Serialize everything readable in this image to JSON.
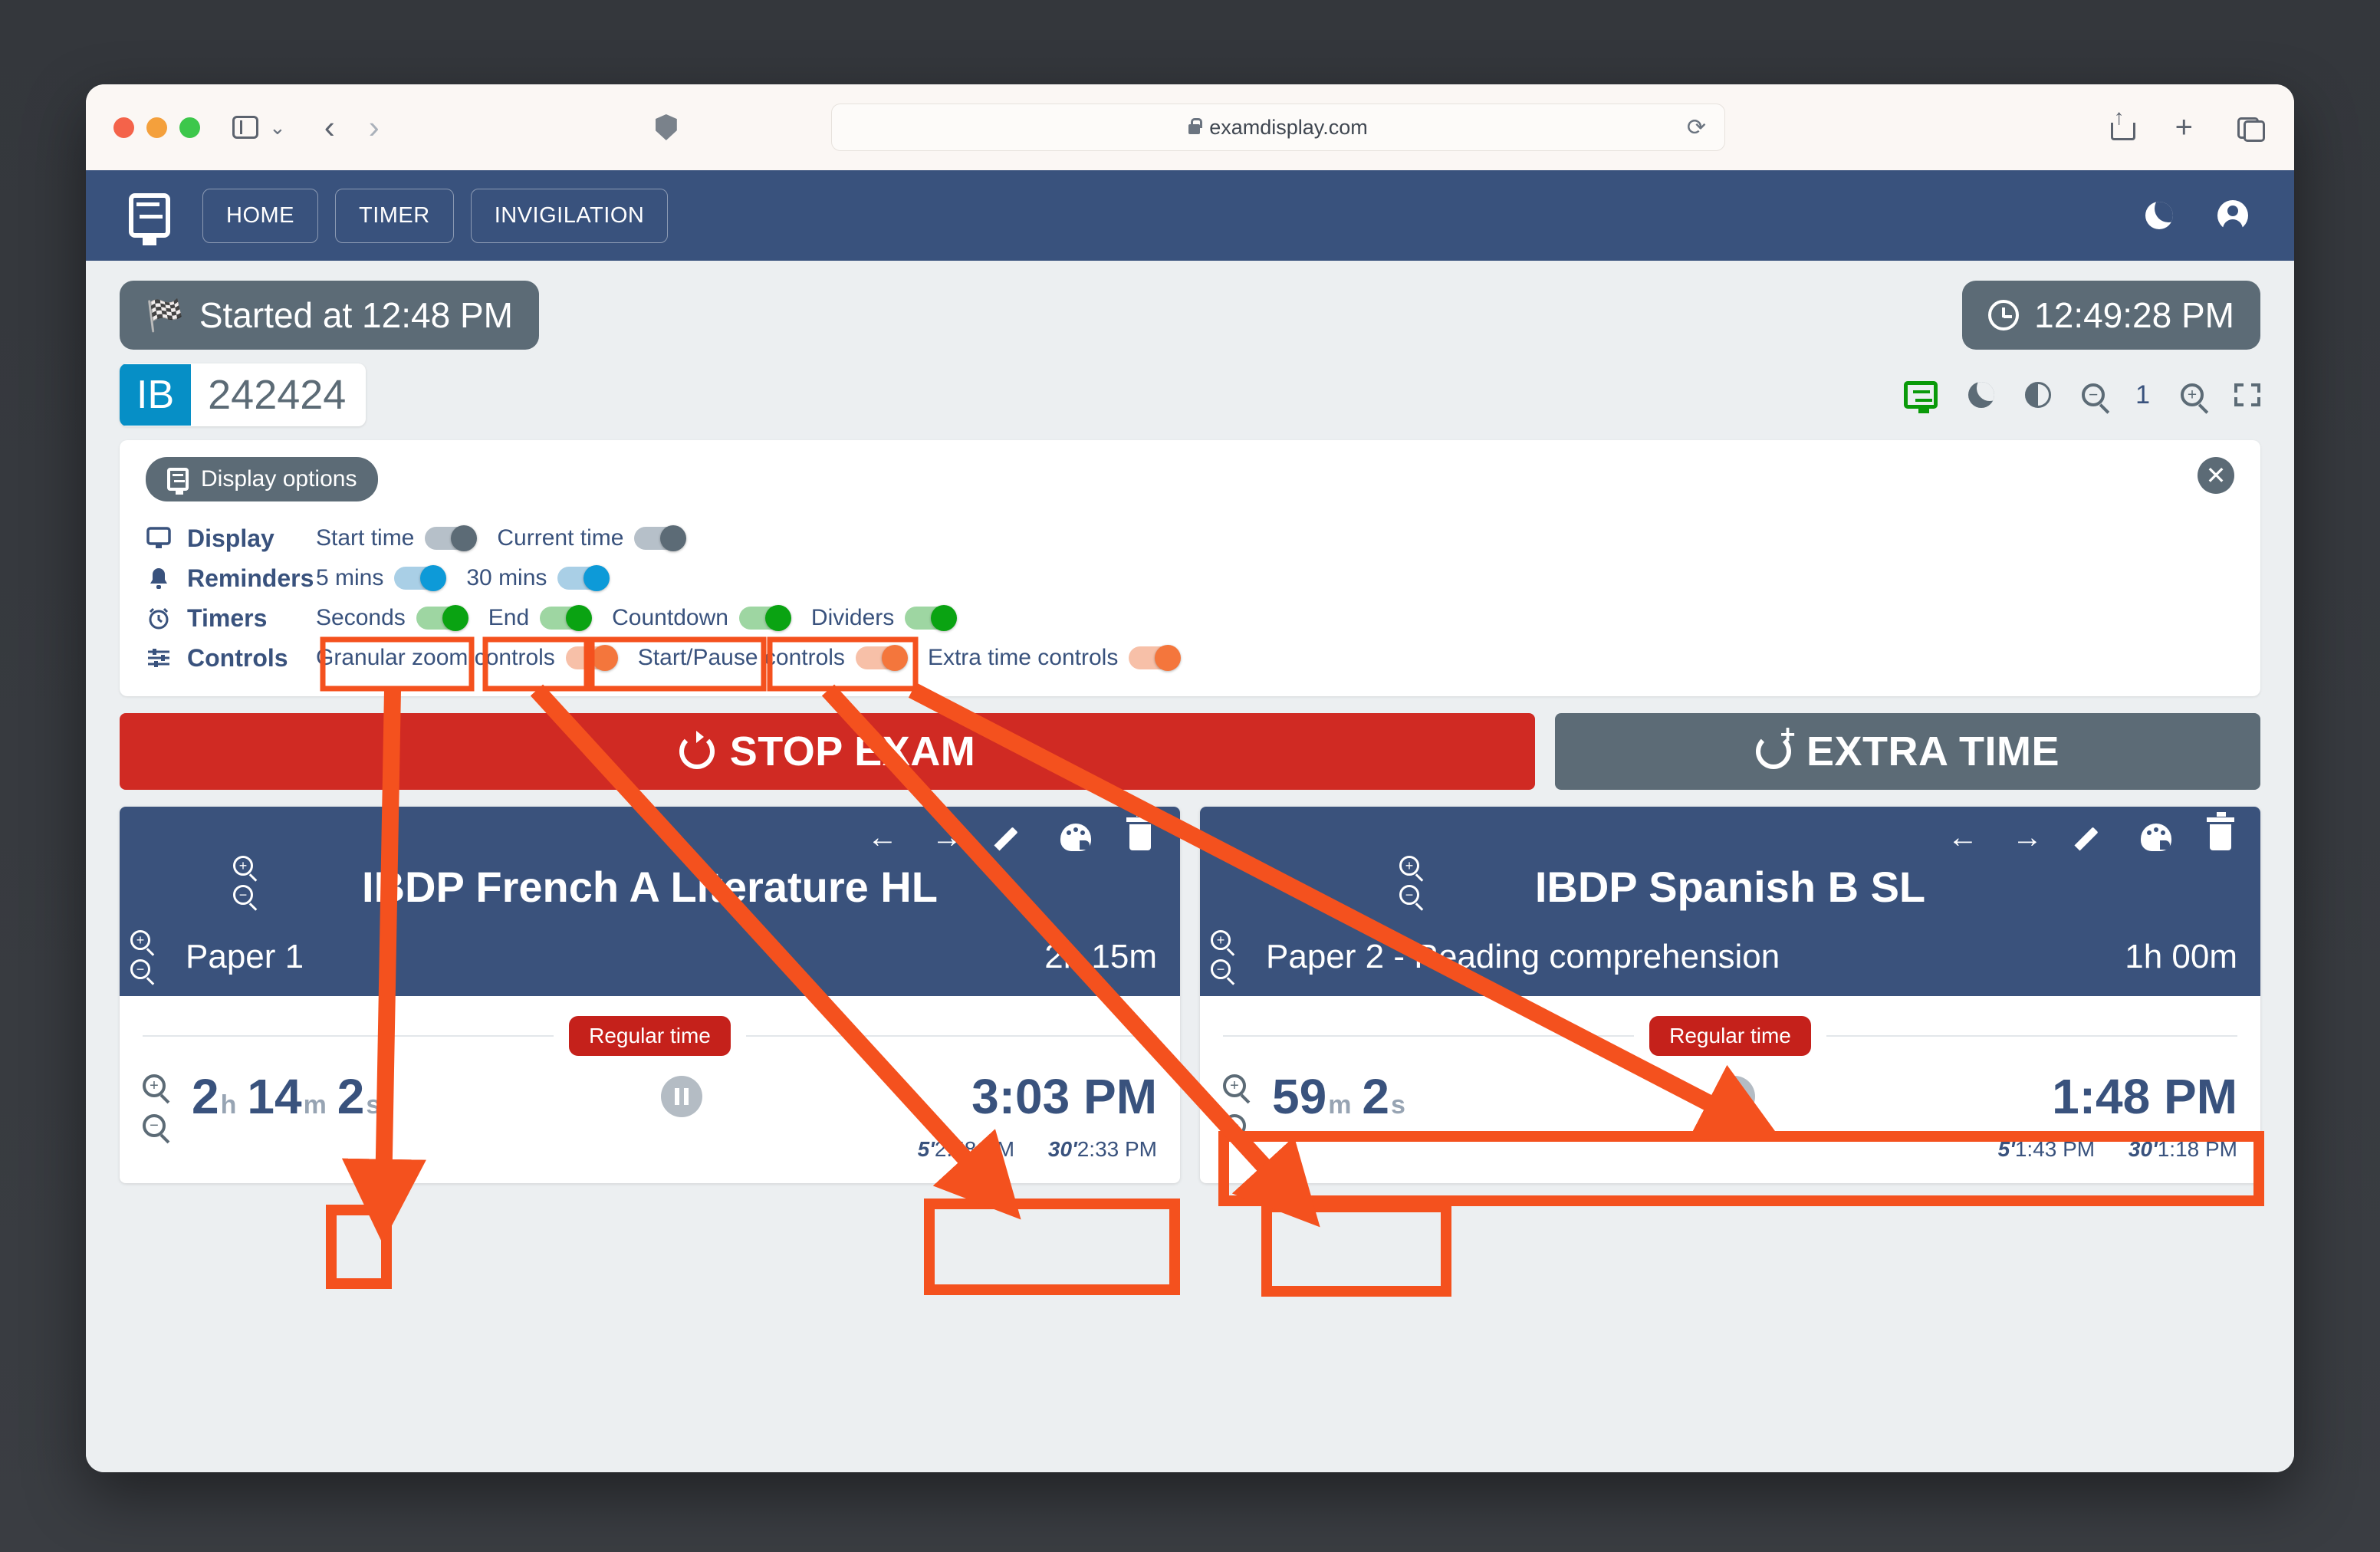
{
  "browser": {
    "url": "examdisplay.com",
    "lock_icon": "lock-icon",
    "reload_icon": "reload-icon",
    "back_icon": "back-arrow-icon",
    "forward_icon": "forward-arrow-icon",
    "sidebar_icon": "sidebar-toggle-icon",
    "shield_icon": "shield-icon",
    "share_icon": "share-icon",
    "newtab_icon": "plus-icon",
    "tabs_icon": "tabs-overview-icon"
  },
  "appnav": {
    "logo_icon": "display-settings-icon",
    "items": [
      {
        "label": "HOME"
      },
      {
        "label": "TIMER"
      },
      {
        "label": "INVIGILATION"
      }
    ],
    "dark_mode_icon": "moon-icon",
    "account_icon": "account-circle-icon"
  },
  "status": {
    "started_label": "Started at 12:48 PM",
    "started_icon": "checkered-flag-icon",
    "current_time": "12:49:28 PM",
    "clock_icon": "clock-icon"
  },
  "exam_code": {
    "tag": "IB",
    "number": "242424",
    "tag_color": "#068fc6"
  },
  "toolbar": {
    "display_options_icon": "display-settings-icon",
    "dark_mode_icon": "moon-icon",
    "contrast_icon": "contrast-icon",
    "zoom_out_icon": "zoom-out-icon",
    "zoom_level": "1",
    "zoom_in_icon": "zoom-in-icon",
    "fullscreen_icon": "fullscreen-icon"
  },
  "options_panel": {
    "chip_label": "Display options",
    "chip_icon": "display-settings-icon",
    "close_icon": "close-icon",
    "rows": [
      {
        "label": "Display",
        "icon": "monitor-icon",
        "items": [
          {
            "label": "Start time",
            "state": "on",
            "color": "gray"
          },
          {
            "label": "Current time",
            "state": "on",
            "color": "gray"
          }
        ]
      },
      {
        "label": "Reminders",
        "icon": "bell-icon",
        "items": [
          {
            "label": "5 mins",
            "state": "on",
            "color": "blue"
          },
          {
            "label": "30 mins",
            "state": "on",
            "color": "blue"
          }
        ]
      },
      {
        "label": "Timers",
        "icon": "alarm-clock-icon",
        "items": [
          {
            "label": "Seconds",
            "state": "on",
            "color": "green"
          },
          {
            "label": "End",
            "state": "on",
            "color": "green"
          },
          {
            "label": "Countdown",
            "state": "on",
            "color": "green"
          },
          {
            "label": "Dividers",
            "state": "on",
            "color": "green"
          }
        ]
      },
      {
        "label": "Controls",
        "icon": "sliders-icon",
        "items": [
          {
            "label": "Granular zoom controls",
            "state": "on",
            "color": "orange"
          },
          {
            "label": "Start/Pause controls",
            "state": "on",
            "color": "orange"
          },
          {
            "label": "Extra time controls",
            "state": "on",
            "color": "orange"
          }
        ]
      }
    ]
  },
  "actions": {
    "stop_label": "STOP EXAM",
    "stop_icon": "stop-restart-icon",
    "stop_color": "#d02a23",
    "extra_label": "EXTRA TIME",
    "extra_icon": "add-time-icon",
    "extra_color": "#5c6b76"
  },
  "cards": [
    {
      "title": "IBDP French A Literature HL",
      "paper": "Paper 1",
      "duration": "2h 15m",
      "badge": "Regular time",
      "remaining": {
        "hours": "2",
        "h_unit": "h",
        "minutes": "14",
        "m_unit": "m",
        "seconds": "2",
        "s_unit": "s"
      },
      "end_time": "3:03 PM",
      "reminder_5_mark": "5'",
      "reminder_5_time": "2:58 PM",
      "reminder_30_mark": "30'",
      "reminder_30_time": "2:33 PM",
      "icons": [
        "back-arrow-icon",
        "forward-arrow-icon",
        "edit-pencil-icon",
        "palette-icon",
        "delete-trash-icon"
      ],
      "pause_icon": "pause-icon"
    },
    {
      "title": "IBDP Spanish B SL",
      "paper": "Paper 2 - Reading comprehension",
      "duration": "1h 00m",
      "badge": "Regular time",
      "remaining": {
        "hours": "",
        "h_unit": "",
        "minutes": "59",
        "m_unit": "m",
        "seconds": "2",
        "s_unit": "s"
      },
      "end_time": "1:48 PM",
      "reminder_5_mark": "5'",
      "reminder_5_time": "1:43 PM",
      "reminder_30_mark": "30'",
      "reminder_30_time": "1:18 PM",
      "icons": [
        "back-arrow-icon",
        "forward-arrow-icon",
        "edit-pencil-icon",
        "palette-icon",
        "delete-trash-icon"
      ],
      "pause_icon": "pause-icon"
    }
  ],
  "annotations": {
    "color": "#f4511e",
    "highlight_count": 9
  }
}
